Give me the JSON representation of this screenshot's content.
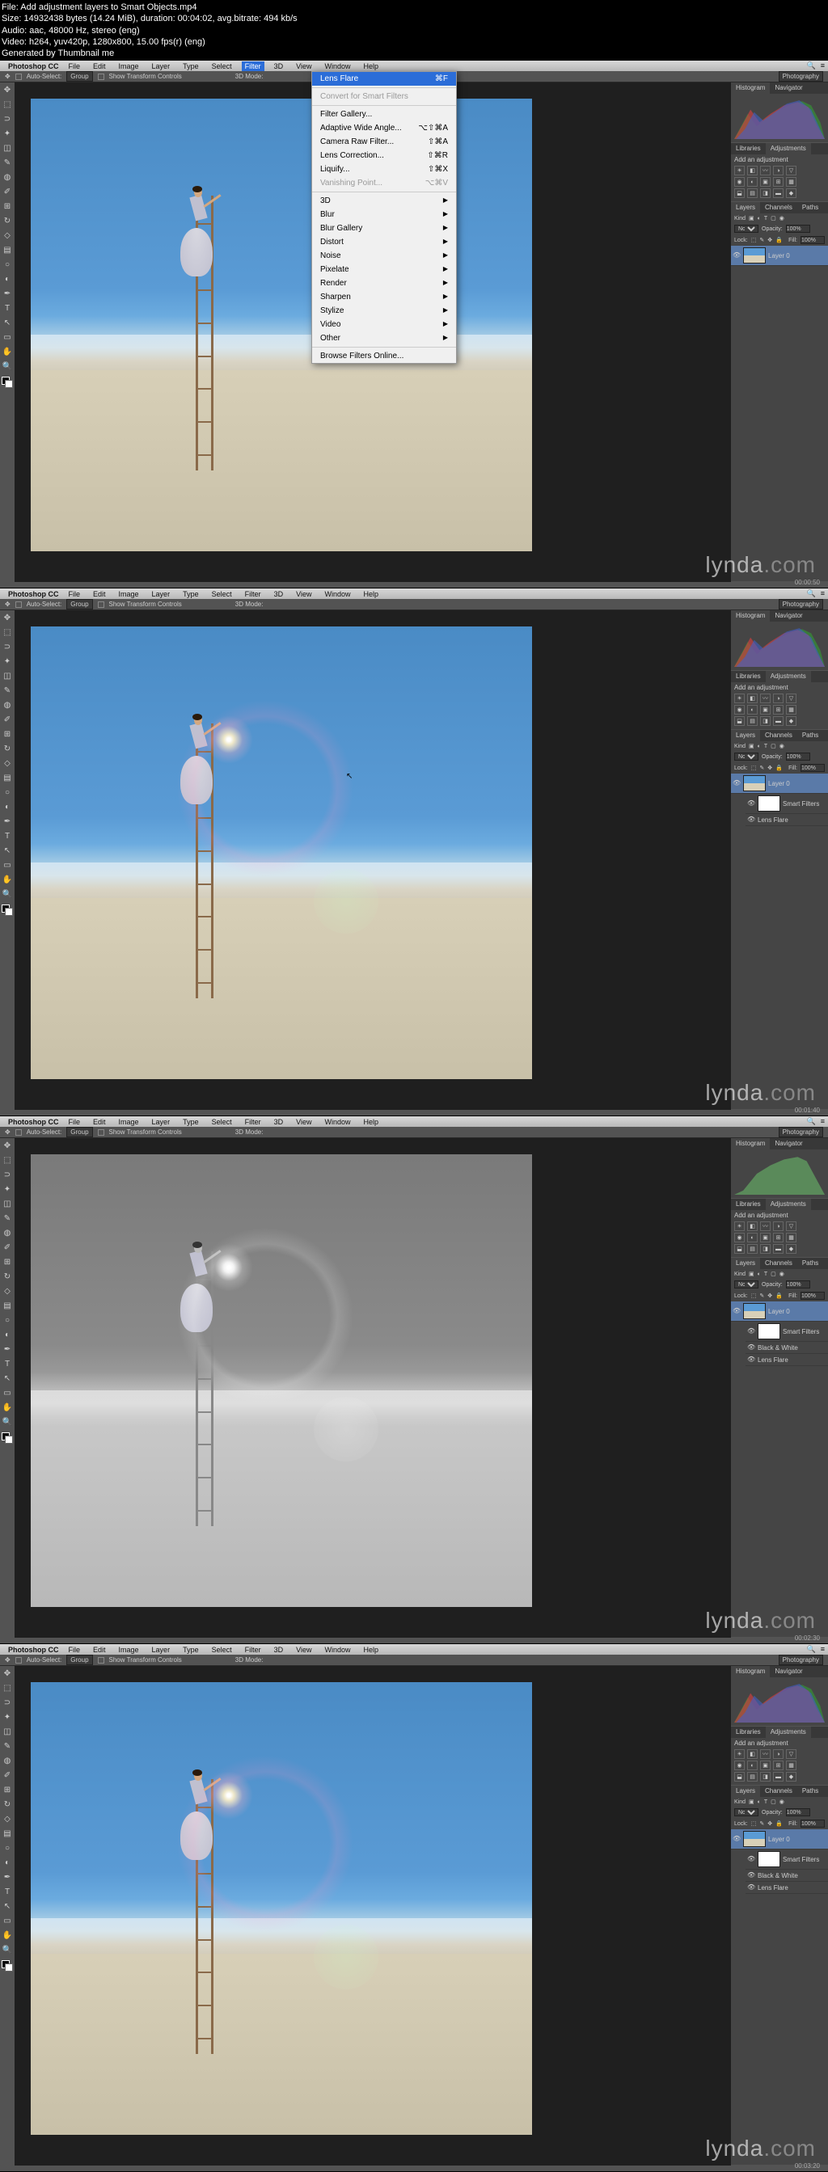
{
  "meta": {
    "file": "File: Add adjustment layers to Smart Objects.mp4",
    "size": "Size: 14932438 bytes (14.24 MiB), duration: 00:04:02, avg.bitrate: 494 kb/s",
    "audio": "Audio: aac, 48000 Hz, stereo (eng)",
    "video": "Video: h264, yuv420p, 1280x800, 15.00 fps(r) (eng)",
    "gen": "Generated by Thumbnail me"
  },
  "app": "Photoshop CC",
  "menu": [
    "File",
    "Edit",
    "Image",
    "Layer",
    "Type",
    "Select",
    "Filter",
    "3D",
    "View",
    "Window",
    "Help"
  ],
  "opt": {
    "auto": "Auto-Select:",
    "group": "Group",
    "show": "Show Transform Controls",
    "mode": "3D Mode:",
    "ws": "Photography"
  },
  "filter_menu": {
    "last": "Lens Flare",
    "last_key": "⌘F",
    "convert": "Convert for Smart Filters",
    "items": [
      {
        "l": "Filter Gallery...",
        "k": ""
      },
      {
        "l": "Adaptive Wide Angle...",
        "k": "⌥⇧⌘A"
      },
      {
        "l": "Camera Raw Filter...",
        "k": "⇧⌘A"
      },
      {
        "l": "Lens Correction...",
        "k": "⇧⌘R"
      },
      {
        "l": "Liquify...",
        "k": "⇧⌘X"
      },
      {
        "l": "Vanishing Point...",
        "k": "⌥⌘V"
      }
    ],
    "sub": [
      "3D",
      "Blur",
      "Blur Gallery",
      "Distort",
      "Noise",
      "Pixelate",
      "Render",
      "Sharpen",
      "Stylize",
      "Video",
      "Other"
    ],
    "browse": "Browse Filters Online..."
  },
  "panels": {
    "histo": "Histogram",
    "nav": "Navigator",
    "lib": "Libraries",
    "adjust": "Adjustments",
    "addadj": "Add an adjustment",
    "layers": "Layers",
    "channels": "Channels",
    "paths": "Paths",
    "kind": "Kind",
    "normal": "Normal",
    "opacity": "Opacity:",
    "op_val": "100%",
    "lock": "Lock:",
    "fill": "Fill:",
    "fill_val": "100%"
  },
  "layer_names": {
    "l0": "Layer 0",
    "sf": "Smart Filters",
    "lf": "Lens Flare",
    "bw": "Black & White"
  },
  "wm": {
    "a": "lynda",
    "b": ".com"
  },
  "ts": [
    "00:00:50",
    "00:01:40",
    "00:02:30",
    "00:03:20"
  ]
}
